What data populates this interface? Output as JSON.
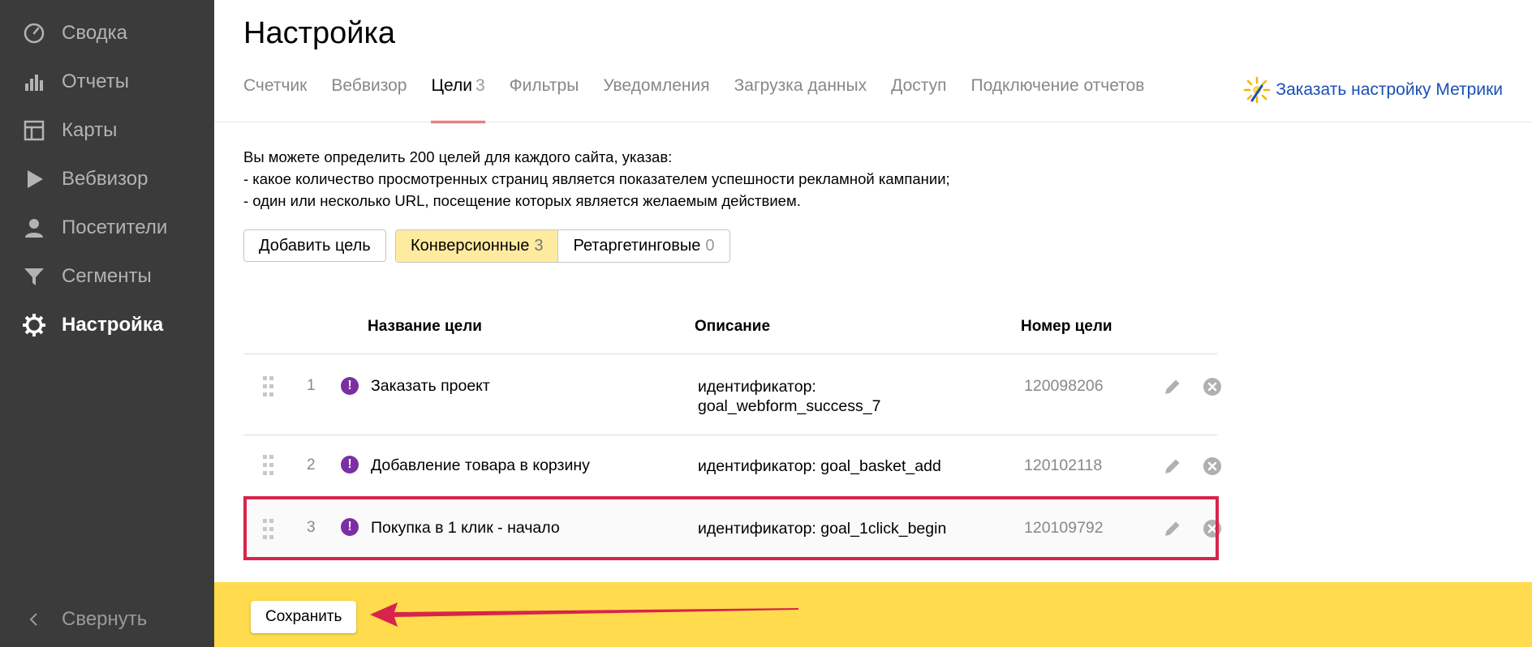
{
  "sidebar": {
    "items": [
      {
        "label": "Сводка",
        "icon": "gauge-icon"
      },
      {
        "label": "Отчеты",
        "icon": "bar-chart-icon"
      },
      {
        "label": "Карты",
        "icon": "map-layout-icon"
      },
      {
        "label": "Вебвизор",
        "icon": "play-icon"
      },
      {
        "label": "Посетители",
        "icon": "user-icon"
      },
      {
        "label": "Сегменты",
        "icon": "filter-icon"
      },
      {
        "label": "Настройка",
        "icon": "gear-icon",
        "active": true
      }
    ],
    "collapse_label": "Свернуть"
  },
  "header": {
    "title": "Настройка",
    "tabs": [
      {
        "label": "Счетчик"
      },
      {
        "label": "Вебвизор"
      },
      {
        "label": "Цели",
        "count": "3",
        "active": true
      },
      {
        "label": "Фильтры"
      },
      {
        "label": "Уведомления"
      },
      {
        "label": "Загрузка данных"
      },
      {
        "label": "Доступ"
      },
      {
        "label": "Подключение отчетов"
      }
    ],
    "order_link": "Заказать настройку Метрики"
  },
  "info": {
    "line1": "Вы можете определить 200 целей для каждого сайта, указав:",
    "line2": "-  какое количество просмотренных страниц является показателем успешности рекламной кампании;",
    "line3": "-  один или несколько URL, посещение которых является желаемым действием."
  },
  "actions": {
    "add_goal": "Добавить цель",
    "filter_conversion": "Конверсионные",
    "filter_conversion_count": "3",
    "filter_retargeting": "Ретаргетинговые",
    "filter_retargeting_count": "0"
  },
  "table": {
    "headers": {
      "name": "Название цели",
      "description": "Описание",
      "number": "Номер цели"
    },
    "rows": [
      {
        "index": "1",
        "name": "Заказать проект",
        "desc1": "идентификатор:",
        "desc2": "goal_webform_success_7",
        "number": "120098206"
      },
      {
        "index": "2",
        "name": "Добавление товара в корзину",
        "desc1": "идентификатор: goal_basket_add",
        "desc2": "",
        "number": "120102118"
      },
      {
        "index": "3",
        "name": "Покупка в 1 клик - начало",
        "desc1": "идентификатор: goal_1click_begin",
        "desc2": "",
        "number": "120109792"
      }
    ]
  },
  "footer": {
    "save_label": "Сохранить"
  },
  "colors": {
    "sidebar_bg": "#3b3b3b",
    "accent": "#ffdb4d",
    "highlight": "#d7244b",
    "tab_underline": "#e53935",
    "warn_badge": "#7b2fa3"
  }
}
